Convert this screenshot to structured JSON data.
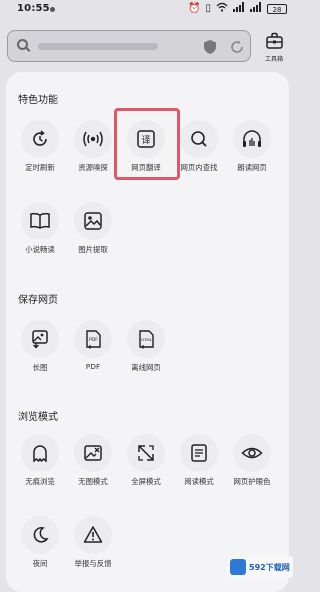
{
  "status_bar": {
    "time": "10:55",
    "battery": "28"
  },
  "toolbox": {
    "label": "工具箱"
  },
  "sections": [
    {
      "title": "特色功能",
      "items": [
        {
          "label": "定时刷新",
          "icon": "timer-refresh-icon"
        },
        {
          "label": "资源嗅探",
          "icon": "sniff-icon"
        },
        {
          "label": "网页翻译",
          "icon": "translate-icon",
          "highlighted": true
        },
        {
          "label": "网页内查找",
          "icon": "find-in-page-icon"
        },
        {
          "label": "朗读网页",
          "icon": "headphones-icon"
        },
        {
          "label": "小说畅读",
          "icon": "book-icon"
        },
        {
          "label": "图片提取",
          "icon": "image-extract-icon"
        }
      ]
    },
    {
      "title": "保存网页",
      "items": [
        {
          "label": "长图",
          "icon": "long-image-icon"
        },
        {
          "label": "PDF",
          "icon": "pdf-icon"
        },
        {
          "label": "离线网页",
          "icon": "offline-html-icon"
        }
      ]
    },
    {
      "title": "浏览模式",
      "items": [
        {
          "label": "无痕浏览",
          "icon": "ghost-icon"
        },
        {
          "label": "无图模式",
          "icon": "no-image-icon"
        },
        {
          "label": "全屏模式",
          "icon": "fullscreen-icon"
        },
        {
          "label": "阅读模式",
          "icon": "reading-mode-icon"
        },
        {
          "label": "网页护眼色",
          "icon": "eye-icon"
        },
        {
          "label": "夜间",
          "icon": "moon-icon"
        },
        {
          "label": "举报与反馈",
          "icon": "warning-icon"
        }
      ]
    }
  ],
  "watermark": {
    "text": "592下载网"
  }
}
